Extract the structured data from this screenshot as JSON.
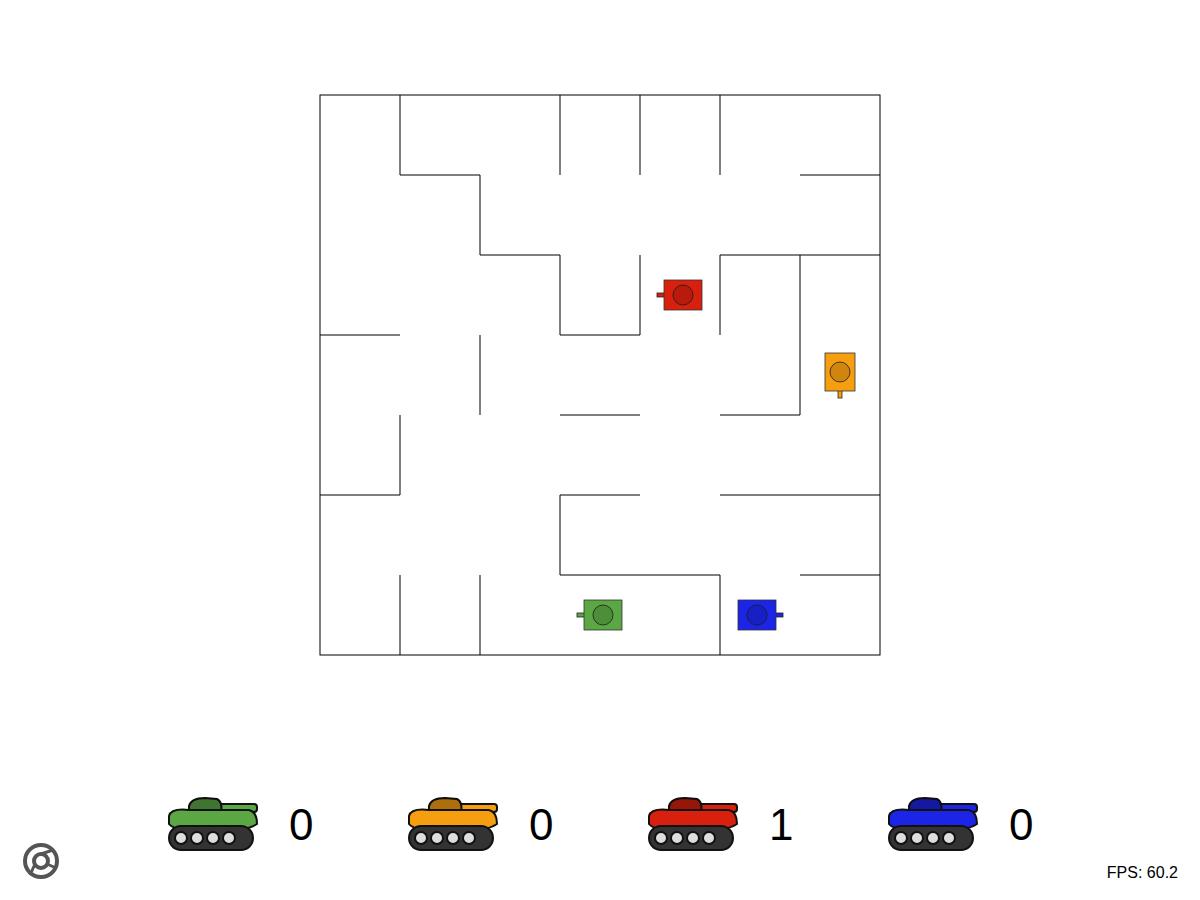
{
  "players": [
    {
      "color": "#5aa744",
      "score": "0",
      "facing": "left"
    },
    {
      "color": "#f59e10",
      "score": "0",
      "facing": "down"
    },
    {
      "color": "#d8200e",
      "score": "1",
      "facing": "left"
    },
    {
      "color": "#1c24e6",
      "score": "0",
      "facing": "right"
    }
  ],
  "fps": "FPS: 60.2"
}
